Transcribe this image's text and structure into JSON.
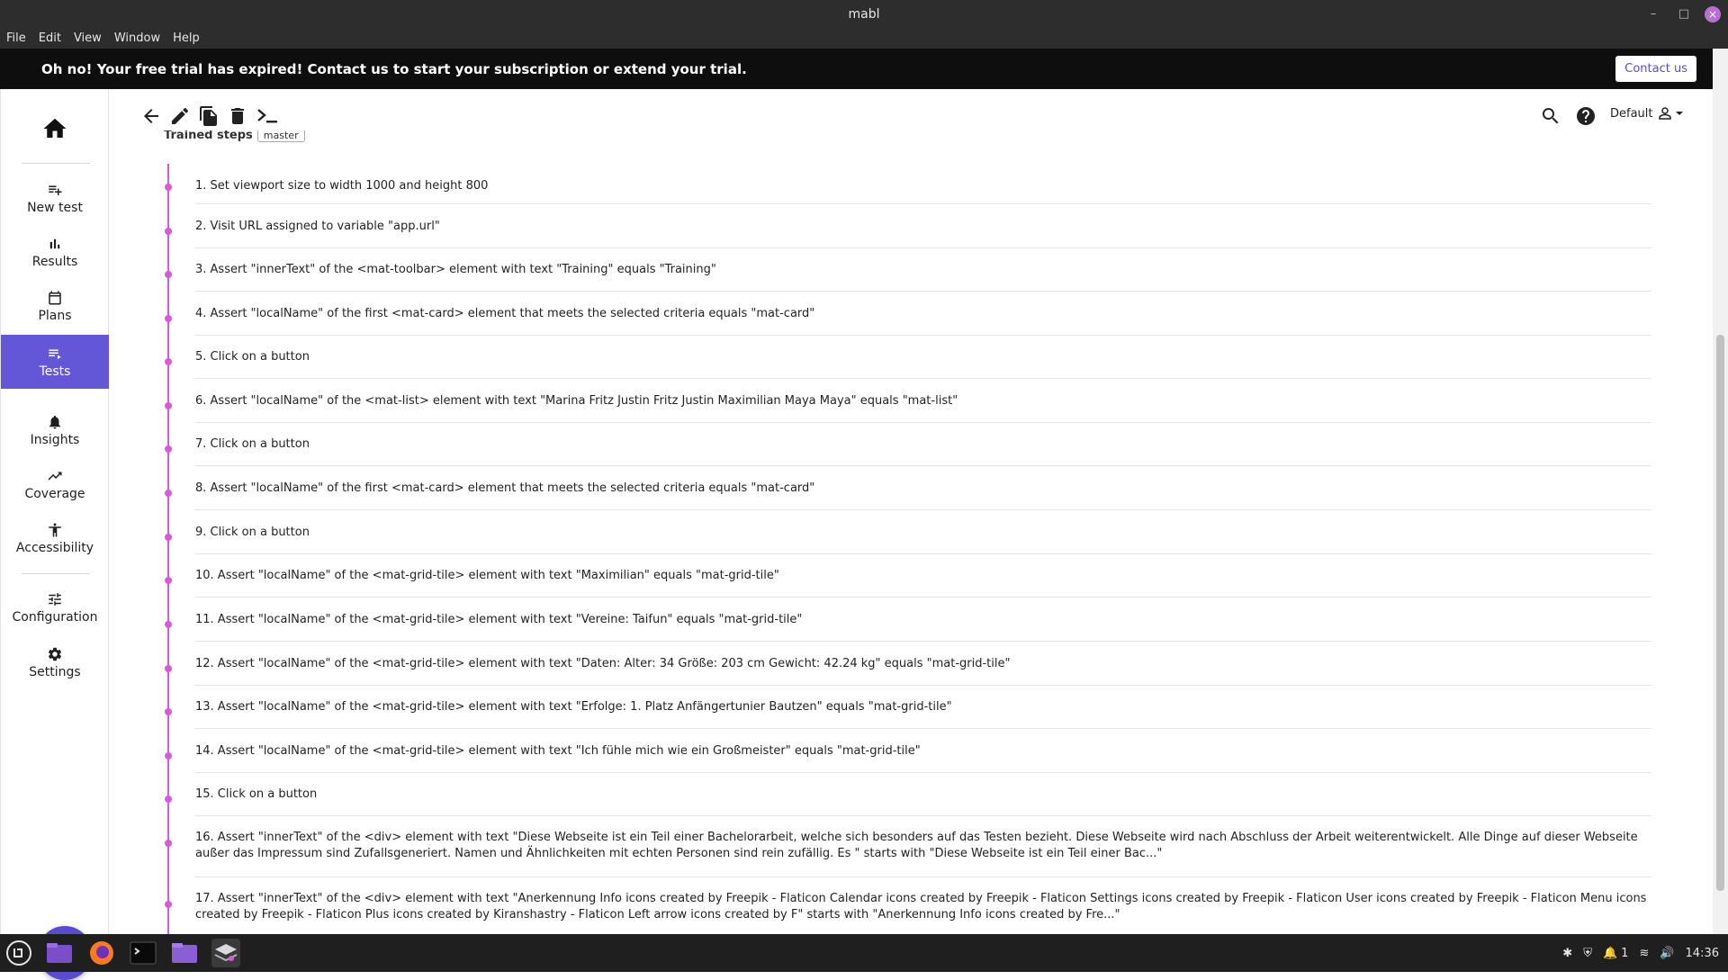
{
  "window": {
    "title": "mabl",
    "minimize": "–",
    "maximize": "□",
    "close": "×"
  },
  "menu": [
    "File",
    "Edit",
    "View",
    "Window",
    "Help"
  ],
  "banner": {
    "message": "Oh no! Your free trial has expired! Contact us to start your subscription or extend your trial.",
    "contact_label": "Contact us"
  },
  "sidebar": {
    "items": [
      {
        "label": "New test",
        "icon": "playlist-add-icon"
      },
      {
        "label": "Results",
        "icon": "bar-chart-icon"
      },
      {
        "label": "Plans",
        "icon": "calendar-icon"
      },
      {
        "label": "Tests",
        "icon": "list-icon"
      },
      {
        "label": "Insights",
        "icon": "bell-icon"
      },
      {
        "label": "Coverage",
        "icon": "trending-up-icon"
      },
      {
        "label": "Accessibility",
        "icon": "accessibility-icon"
      },
      {
        "label": "Configuration",
        "icon": "sliders-icon"
      },
      {
        "label": "Settings",
        "icon": "gear-icon"
      }
    ],
    "active": "Tests"
  },
  "header": {
    "workspace": "Default",
    "section_title": "Trained steps",
    "branch": "master"
  },
  "steps": [
    "1. Set viewport size to width 1000 and height 800",
    "2. Visit URL assigned to variable \"app.url\"",
    "3. Assert \"innerText\" of the <mat-toolbar> element with text \"Training\" equals \"Training\"",
    "4. Assert \"localName\" of the first <mat-card> element that meets the selected criteria equals \"mat-card\"",
    "5. Click on a button",
    "6. Assert \"localName\" of the <mat-list> element with text \"Marina Fritz Justin Fritz Justin Maximilian Maya Maya\" equals \"mat-list\"",
    "7. Click on a button",
    "8. Assert \"localName\" of the first <mat-card> element that meets the selected criteria equals \"mat-card\"",
    "9. Click on a button",
    "10. Assert \"localName\" of the <mat-grid-tile> element with text \"Maximilian\" equals \"mat-grid-tile\"",
    "11. Assert \"localName\" of the <mat-grid-tile> element with text \"Vereine: Taifun\" equals \"mat-grid-tile\"",
    "12. Assert \"localName\" of the <mat-grid-tile> element with text \"Daten: Alter: 34 Größe: 203 cm Gewicht: 42.24 kg\" equals \"mat-grid-tile\"",
    "13. Assert \"localName\" of the <mat-grid-tile> element with text \"Erfolge: 1. Platz Anfängertunier Bautzen\" equals \"mat-grid-tile\"",
    "14. Assert \"localName\" of the <mat-grid-tile> element with text \"Ich fühle mich wie ein Großmeister\" equals \"mat-grid-tile\"",
    "15. Click on a button",
    "16. Assert \"innerText\" of the <div> element with text \"Diese Webseite ist ein Teil einer Bachelorarbeit, welche sich besonders auf das Testen bezieht. Diese Webseite wird nach Abschluss der Arbeit weiterentwickelt. Alle Dinge auf dieser Webseite außer das Impressum sind Zufallsgeneriert. Namen und Ähnlichkeiten mit echten Personen sind rein zufällig. Es \" starts with \"Diese Webseite ist ein Teil einer Bac...\"",
    "17. Assert \"innerText\" of the <div> element with text \"Anerkennung Info icons created by Freepik - Flaticon Calendar icons created by Freepik - Flaticon Settings icons created by Freepik - Flaticon User icons created by Freepik - Flaticon Menu icons created by Freepik - Flaticon Plus icons created by Kiranshastry - Flaticon Left arrow icons created by F\" starts with \"Anerkennung Info icons created by Fre...\""
  ],
  "tray": {
    "notifications": "1",
    "time": "14:36"
  },
  "colors": {
    "accent": "#6357d8",
    "timeline": "#d95ad6",
    "banner_bg": "#0e0e0e"
  }
}
